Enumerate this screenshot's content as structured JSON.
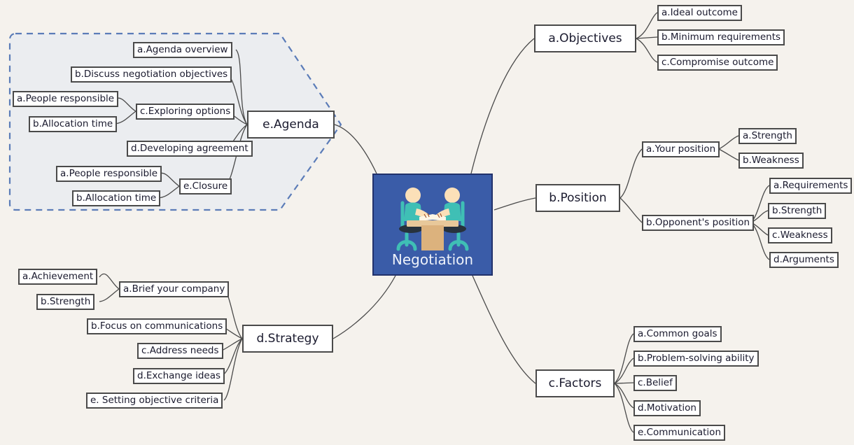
{
  "diagram": {
    "type": "mind-map",
    "title": "Negotiation",
    "background_color": "#f5f2ed",
    "center_color": "#3a5ca8",
    "node_border_color": "#4a4a4a",
    "region_border_color": "#5b7cb8",
    "region_fill_color": "#ebedf0"
  },
  "center": {
    "label": "Negotiation",
    "icon": "negotiation-table-illustration"
  },
  "branches": {
    "objectives": {
      "label": "a.Objectives",
      "children": [
        {
          "label": "a.Ideal outcome"
        },
        {
          "label": "b.Minimum requirements"
        },
        {
          "label": "c.Compromise outcome"
        }
      ]
    },
    "position": {
      "label": "b.Position",
      "children": [
        {
          "label": "a.Your position",
          "children": [
            {
              "label": "a.Strength"
            },
            {
              "label": "b.Weakness"
            }
          ]
        },
        {
          "label": "b.Opponent's position",
          "children": [
            {
              "label": "a.Requirements"
            },
            {
              "label": "b.Strength"
            },
            {
              "label": "c.Weakness"
            },
            {
              "label": "d.Arguments"
            }
          ]
        }
      ]
    },
    "factors": {
      "label": "c.Factors",
      "children": [
        {
          "label": "a.Common goals"
        },
        {
          "label": "b.Problem-solving ability"
        },
        {
          "label": "c.Belief"
        },
        {
          "label": "d.Motivation"
        },
        {
          "label": "e.Communication"
        }
      ]
    },
    "strategy": {
      "label": "d.Strategy",
      "children": [
        {
          "label": "a.Brief your company",
          "children": [
            {
              "label": "a.Achievement"
            },
            {
              "label": "b.Strength"
            }
          ]
        },
        {
          "label": "b.Focus on communications"
        },
        {
          "label": "c.Address needs"
        },
        {
          "label": "d.Exchange ideas"
        },
        {
          "label": "e. Setting objective criteria"
        }
      ]
    },
    "agenda": {
      "label": "e.Agenda",
      "children": [
        {
          "label": "a.Agenda overview"
        },
        {
          "label": "b.Discuss negotiation objectives"
        },
        {
          "label": "c.Exploring options",
          "children": [
            {
              "label": "a.People responsible"
            },
            {
              "label": "b.Allocation time"
            }
          ]
        },
        {
          "label": "d.Developing agreement"
        },
        {
          "label": "e.Closure",
          "children": [
            {
              "label": "a.People responsible"
            },
            {
              "label": "b.Allocation time"
            }
          ]
        }
      ]
    }
  }
}
